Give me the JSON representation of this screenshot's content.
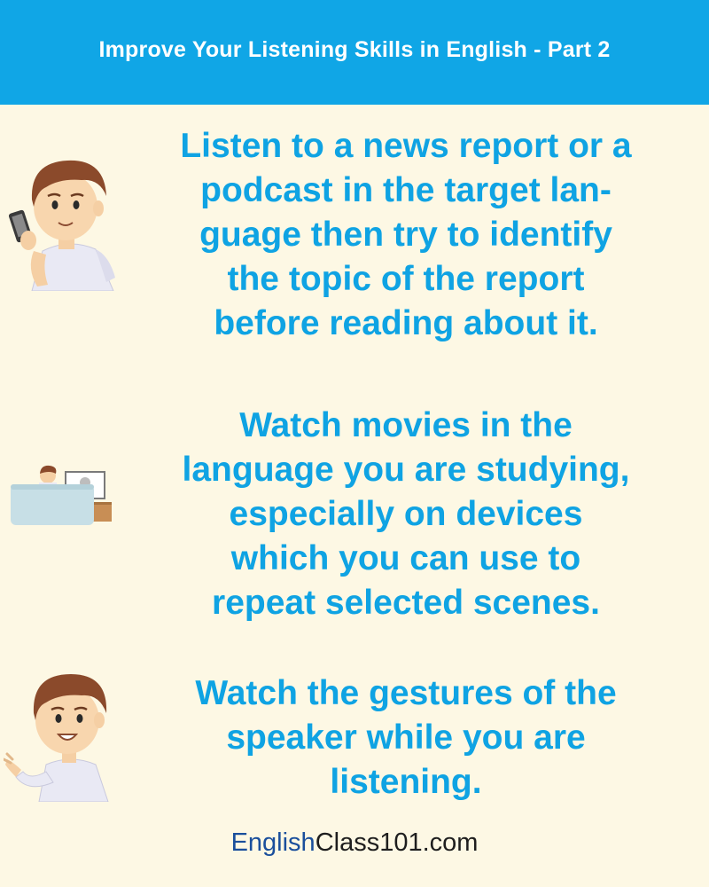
{
  "header": {
    "title": "Improve Your Listening Skills in English - Part 2"
  },
  "tips": [
    {
      "lines": [
        "Listen to a news report or a",
        "podcast in the target lan-",
        "guage then try to identify",
        "the topic of the report",
        "before reading about it."
      ]
    },
    {
      "lines": [
        "Watch movies in the",
        "language you are studying,",
        "especially on devices",
        "which you can use to",
        "repeat selected scenes."
      ]
    },
    {
      "lines": [
        "Watch the gestures of the",
        "speaker while you are",
        "listening."
      ]
    }
  ],
  "footer": {
    "brand_part1": "English",
    "brand_part2": "Class101.com"
  },
  "colors": {
    "header_bg": "#10a6e6",
    "background": "#fdf8e4",
    "tip_text": "#0fa3e3",
    "brand_dark_blue": "#1a4f9c"
  },
  "illustrations": [
    "man-with-phone-icon",
    "person-watching-tv-icon",
    "man-gesturing-icon"
  ]
}
